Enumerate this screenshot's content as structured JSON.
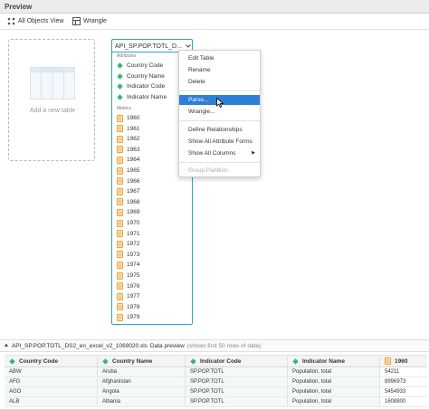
{
  "header": {
    "title": "Preview"
  },
  "toolbar": {
    "all_objects_label": "All Objects View",
    "wrangle_label": "Wrangle"
  },
  "add_table": {
    "label": "Add a new table"
  },
  "table_card": {
    "title": "API_SP.POP.TOTL_D...",
    "attributes_label": "Attributes",
    "attributes": [
      "Country Code",
      "Country Name",
      "Indicator Code",
      "Indicator Name"
    ],
    "metrics_label": "Metrics",
    "metrics": [
      "1960",
      "1961",
      "1962",
      "1963",
      "1964",
      "1965",
      "1966",
      "1967",
      "1968",
      "1969",
      "1970",
      "1971",
      "1972",
      "1973",
      "1974",
      "1975",
      "1976",
      "1977",
      "1978",
      "1979"
    ]
  },
  "context_menu": {
    "items": [
      "Edit Table",
      "Rename",
      "Delete",
      "Parse...",
      "Wrangle...",
      "Define Relationships",
      "Show All Attribute Forms",
      "Show All Columns",
      "Group Partition"
    ],
    "active_item": "Parse...",
    "disabled_item": "Group Partition"
  },
  "data_preview": {
    "filename": "API_SP.POP.TOTL_DS2_en_excel_v2_1069020.xls",
    "label": "Data preview",
    "note": "(shows first 50 rows of data)"
  },
  "grid": {
    "columns": [
      "Country Code",
      "Country Name",
      "Indicator Code",
      "Indicator Name",
      "1960"
    ],
    "rows": [
      [
        "ABW",
        "Aruba",
        "SP.POP.TOTL",
        "Population, total",
        "54211"
      ],
      [
        "AFG",
        "Afghanistan",
        "SP.POP.TOTL",
        "Population, total",
        "8996973"
      ],
      [
        "AGO",
        "Angola",
        "SP.POP.TOTL",
        "Population, total",
        "5454933"
      ],
      [
        "ALB",
        "Albania",
        "SP.POP.TOTL",
        "Population, total",
        "1608800"
      ]
    ]
  },
  "colors": {
    "accent": "#2ea3c9",
    "attribute": "#3bb37a",
    "metric": "#f0a030",
    "menu_highlight": "#2e7fd6"
  }
}
